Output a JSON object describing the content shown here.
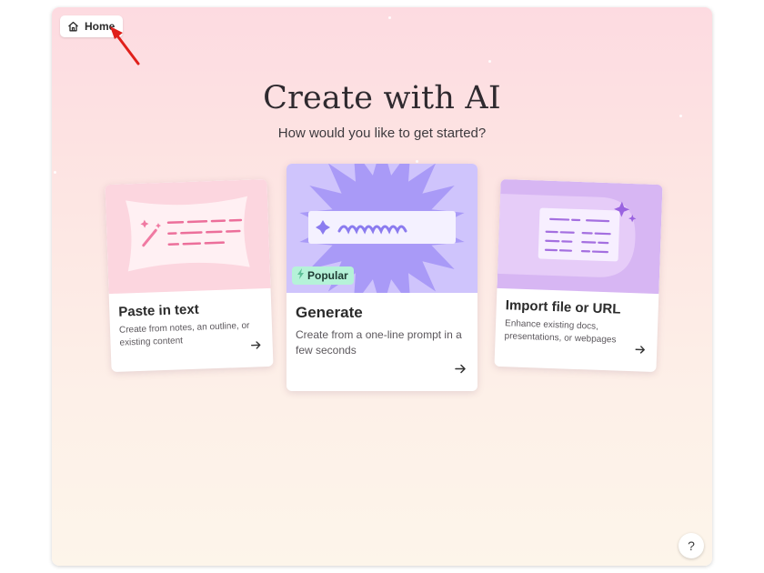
{
  "nav": {
    "home_label": "Home"
  },
  "header": {
    "title": "Create with AI",
    "subtitle": "How would you like to get started?"
  },
  "cards": [
    {
      "title": "Paste in text",
      "description": "Create from notes, an outline, or existing content",
      "icon": "magic-wand-icon"
    },
    {
      "title": "Generate",
      "description": "Create from a one-line prompt in a few seconds",
      "badge": "Popular",
      "icon": "lightning-icon"
    },
    {
      "title": "Import file or URL",
      "description": "Enhance existing docs, presentations, or webpages",
      "icon": "sparkle-icon"
    }
  ],
  "help": {
    "label": "?"
  },
  "colors": {
    "paste_art": "#fcd6df",
    "generate_art": "#cfc4fc",
    "import_art": "#d7b6f3",
    "badge": "#b5f2d8",
    "pointer": "#e0201b"
  }
}
